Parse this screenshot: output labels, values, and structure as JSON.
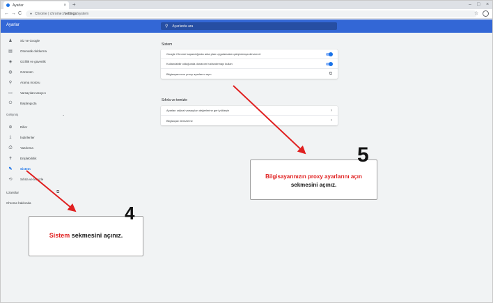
{
  "tab": {
    "title": "Ayarlar",
    "close_glyph": "×",
    "new_tab_glyph": "+"
  },
  "window_controls": {
    "minimize": "–",
    "maximize": "□",
    "close": "×"
  },
  "toolbar": {
    "back_glyph": "←",
    "forward_glyph": "→",
    "reload_glyph": "C",
    "url_origin": "Chrome | chrome://",
    "url_path": "settings",
    "url_tail": "/system",
    "star_glyph": "☆"
  },
  "header": {
    "title": "Ayarlar",
    "search_placeholder": "Ayarlarda ara"
  },
  "sidebar": {
    "items": [
      {
        "label": "Siz ve Google",
        "icon": "person-icon",
        "glyph": "♟"
      },
      {
        "label": "Otomatik doldurma",
        "icon": "clipboard-icon",
        "glyph": "▤"
      },
      {
        "label": "Gizlilik ve güvenlik",
        "icon": "shield-icon",
        "glyph": "◈"
      },
      {
        "label": "Görünüm",
        "icon": "palette-icon",
        "glyph": "◍"
      },
      {
        "label": "Arama motoru",
        "icon": "search-icon",
        "glyph": "⚲"
      },
      {
        "label": "Varsayılan tarayıcı",
        "icon": "browser-icon",
        "glyph": "▭"
      },
      {
        "label": "Başlangıçta",
        "icon": "power-icon",
        "glyph": "⏻"
      }
    ],
    "advanced_label": "Gelişmiş",
    "advanced_chevron": "⌄",
    "advanced_items": [
      {
        "label": "Diller",
        "icon": "globe-icon",
        "glyph": "⊕"
      },
      {
        "label": "İndirilenler",
        "icon": "download-icon",
        "glyph": "⤓"
      },
      {
        "label": "Yazdırma",
        "icon": "printer-icon",
        "glyph": "⎙"
      },
      {
        "label": "Erişilebilirlik",
        "icon": "accessibility-icon",
        "glyph": "✝"
      },
      {
        "label": "Sistem",
        "icon": "wrench-icon",
        "glyph": "🔧",
        "active": true
      },
      {
        "label": "Sıfırla ve temizle",
        "icon": "reset-icon",
        "glyph": "⟲"
      }
    ],
    "extensions_label": "Uzantılar",
    "extensions_icon_glyph": "⧉",
    "about_label": "Chrome hakkında"
  },
  "main": {
    "system_section_title": "Sistem",
    "system_rows": [
      {
        "label": "Google Chrome kapandığında arka plan uygulamaları çalıştırmaya devam et",
        "control": "toggle",
        "on": true
      },
      {
        "label": "Kullanılabilir olduğunda donanım hızlandırmayı kullan",
        "control": "toggle",
        "on": true
      },
      {
        "label": "Bilgisayarınızın proxy ayarlarını açın",
        "control": "external-link",
        "glyph": "⧉"
      }
    ],
    "reset_section_title": "Sıfırla ve temizle",
    "reset_rows": [
      {
        "label": "Ayarları orijinal varsayılan değerlerine geri yükleyin",
        "glyph": "›"
      },
      {
        "label": "Bilgisayarı temizleme",
        "glyph": "›"
      }
    ]
  },
  "annotations": {
    "step4": {
      "number": "4",
      "highlight": "Sistem",
      "text": " sekmesini açınız."
    },
    "step5": {
      "number": "5",
      "highlight": "Bilgisayarınızın proxy ayarlarını açın",
      "text": "sekmesini açınız."
    },
    "arrow_color": "#e02020"
  }
}
